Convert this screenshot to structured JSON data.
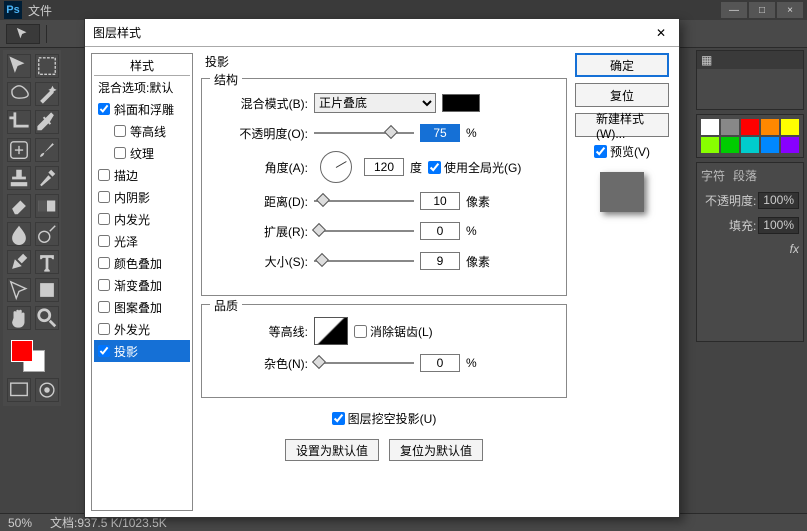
{
  "titlebar": {
    "menu_file": "文件"
  },
  "window_controls": {
    "min": "—",
    "max": "□",
    "close": "×"
  },
  "statusbar": {
    "zoom": "50%",
    "docinfo": "文档:937.5 K/1023.5K"
  },
  "right": {
    "tabs_char": "字符",
    "tabs_para": "段落",
    "opacity_label": "不透明度:",
    "opacity_val": "100%",
    "fill_label": "填充:",
    "fill_val": "100%",
    "fx": "fx"
  },
  "dialog": {
    "title": "图层样式",
    "left": {
      "hdr": "样式",
      "blending_defaults": "混合选项:默认",
      "items": [
        {
          "label": "斜面和浮雕",
          "check": true
        },
        {
          "label": "等高线",
          "check": false,
          "indent": true
        },
        {
          "label": "纹理",
          "check": false,
          "indent": true
        },
        {
          "label": "描边",
          "check": false
        },
        {
          "label": "内阴影",
          "check": false
        },
        {
          "label": "内发光",
          "check": false
        },
        {
          "label": "光泽",
          "check": false
        },
        {
          "label": "颜色叠加",
          "check": false
        },
        {
          "label": "渐变叠加",
          "check": false
        },
        {
          "label": "图案叠加",
          "check": false
        },
        {
          "label": "外发光",
          "check": false
        },
        {
          "label": "投影",
          "check": true,
          "selected": true
        }
      ]
    },
    "section_title": "投影",
    "group_struct": "结构",
    "blend_mode_label": "混合模式(B):",
    "blend_mode_value": "正片叠底",
    "opacity_label": "不透明度(O):",
    "opacity_value": "75",
    "pct": "%",
    "angle_label": "角度(A):",
    "angle_value": "120",
    "angle_unit": "度",
    "global_light": "使用全局光(G)",
    "distance_label": "距离(D):",
    "distance_value": "10",
    "px": "像素",
    "spread_label": "扩展(R):",
    "spread_value": "0",
    "size_label": "大小(S):",
    "size_value": "9",
    "group_qual": "品质",
    "contour_label": "等高线:",
    "antialias": "消除锯齿(L)",
    "noise_label": "杂色(N):",
    "noise_value": "0",
    "knockout": "图层挖空投影(U)",
    "make_default": "设置为默认值",
    "reset_default": "复位为默认值",
    "ok": "确定",
    "cancel": "复位",
    "new_style": "新建样式(W)...",
    "preview": "预览(V)"
  }
}
